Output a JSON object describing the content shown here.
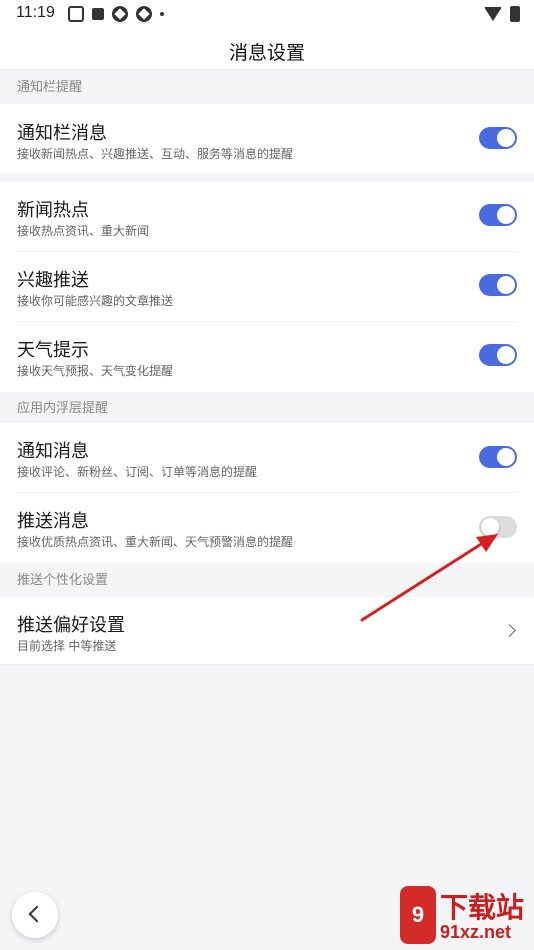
{
  "status_bar": {
    "time": "11:19",
    "icons": [
      "paw-icon",
      "square-icon",
      "ball-icon",
      "ball-icon",
      "dot-icon"
    ],
    "right_icons": [
      "wifi-icon",
      "battery-icon"
    ]
  },
  "header": {
    "title": "消息设置"
  },
  "sections": [
    {
      "header": "通知栏提醒"
    },
    {
      "header": ""
    },
    {
      "header": "应用内浮层提醒"
    },
    {
      "header": "推送个性化设置"
    }
  ],
  "items": [
    {
      "title": "通知栏消息",
      "subtitle": "接收新闻热点、兴趣推送、互动、服务等消息的提醒",
      "on": true
    },
    {
      "title": "新闻热点",
      "subtitle": "接收热点资讯、重大新闻",
      "on": true
    },
    {
      "title": "兴趣推送",
      "subtitle": "接收你可能感兴趣的文章推送",
      "on": true
    },
    {
      "title": "天气提示",
      "subtitle": "接收天气预报、天气变化提醒",
      "on": true
    },
    {
      "title": "通知消息",
      "subtitle": "接收评论、新粉丝、订阅、订单等消息的提醒",
      "on": true
    },
    {
      "title": "推送消息",
      "subtitle": "接收优质热点资讯、重大新闻、天气预警消息的提醒",
      "on": false
    },
    {
      "title": "推送偏好设置",
      "subtitle": "目前选择 中等推送"
    }
  ],
  "colors": {
    "accent": "#4a6bdf",
    "annotation_arrow": "#d62020",
    "watermark": "#c81e1e"
  },
  "watermark": {
    "logo_text": "9",
    "title": "下载站",
    "url": "91xz.net"
  }
}
